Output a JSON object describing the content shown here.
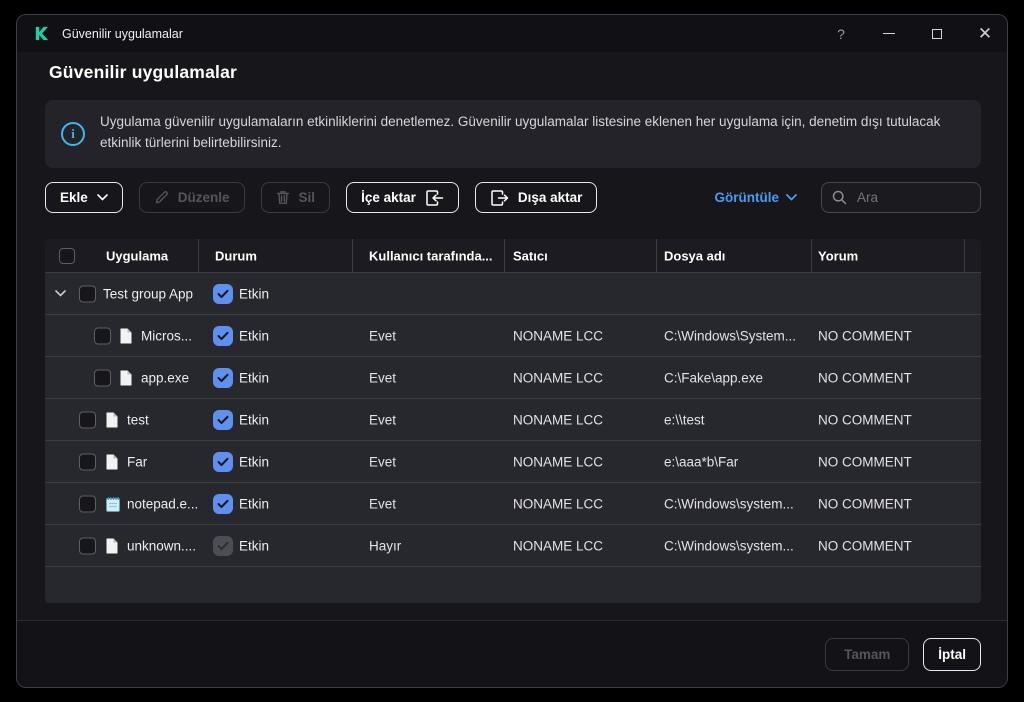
{
  "window": {
    "title": "Güvenilir uygulamalar"
  },
  "icons": {
    "help": "?",
    "close": "✕",
    "info": "i"
  },
  "page": {
    "title": "Güvenilir uygulamalar"
  },
  "banner": {
    "text": "Uygulama güvenilir uygulamaların etkinliklerini denetlemez. Güvenilir uygulamalar listesine eklenen her uygulama için, denetim dışı tutulacak etkinlik türlerini belirtebilirsiniz."
  },
  "toolbar": {
    "add_label": "Ekle",
    "edit_label": "Düzenle",
    "delete_label": "Sil",
    "import_label": "İçe aktar",
    "export_label": "Dışa aktar",
    "view_label": "Görüntüle",
    "search_placeholder": "Ara"
  },
  "table": {
    "headers": [
      "Uygulama",
      "Durum",
      "Kullanıcı tarafında...",
      "Satıcı",
      "Dosya adı",
      "Yorum"
    ],
    "rows": [
      {
        "indent": "group",
        "name": "Test group App",
        "icon": null,
        "status": "Etkin",
        "status_checked": true,
        "status_enabled": true,
        "user": "",
        "vendor": "",
        "path": "",
        "comment": ""
      },
      {
        "indent": "child",
        "name": "Micros...",
        "icon": "file",
        "status": "Etkin",
        "status_checked": true,
        "status_enabled": true,
        "user": "Evet",
        "vendor": "NONAME LCC",
        "path": "C:\\Windows\\System...",
        "comment": "NO COMMENT"
      },
      {
        "indent": "child",
        "name": "app.exe",
        "icon": "file",
        "status": "Etkin",
        "status_checked": true,
        "status_enabled": true,
        "user": "Evet",
        "vendor": "NONAME LCC",
        "path": "C:\\Fake\\app.exe",
        "comment": "NO COMMENT"
      },
      {
        "indent": "item",
        "name": "test",
        "icon": "file",
        "status": "Etkin",
        "status_checked": true,
        "status_enabled": true,
        "user": "Evet",
        "vendor": "NONAME LCC",
        "path": "e:\\\\test",
        "comment": "NO COMMENT"
      },
      {
        "indent": "item",
        "name": "Far",
        "icon": "file",
        "status": "Etkin",
        "status_checked": true,
        "status_enabled": true,
        "user": "Evet",
        "vendor": "NONAME LCC",
        "path": "e:\\aaa*b\\Far",
        "comment": "NO COMMENT"
      },
      {
        "indent": "item",
        "name": "notepad.e...",
        "icon": "notepad",
        "status": "Etkin",
        "status_checked": true,
        "status_enabled": true,
        "user": "Evet",
        "vendor": "NONAME LCC",
        "path": "C:\\Windows\\system...",
        "comment": "NO COMMENT"
      },
      {
        "indent": "item",
        "name": "unknown....",
        "icon": "file",
        "status": "Etkin",
        "status_checked": true,
        "status_enabled": false,
        "user": "Hayır",
        "vendor": "NONAME LCC",
        "path": "C:\\Windows\\system...",
        "comment": "NO COMMENT"
      }
    ]
  },
  "footer": {
    "ok_label": "Tamam",
    "cancel_label": "İptal"
  },
  "colors": {
    "accent_blue": "#4d9bf0",
    "checkbox_blue": "#6090ee",
    "logo_teal": "#1fd0a5",
    "info_blue": "#41b6e8"
  }
}
